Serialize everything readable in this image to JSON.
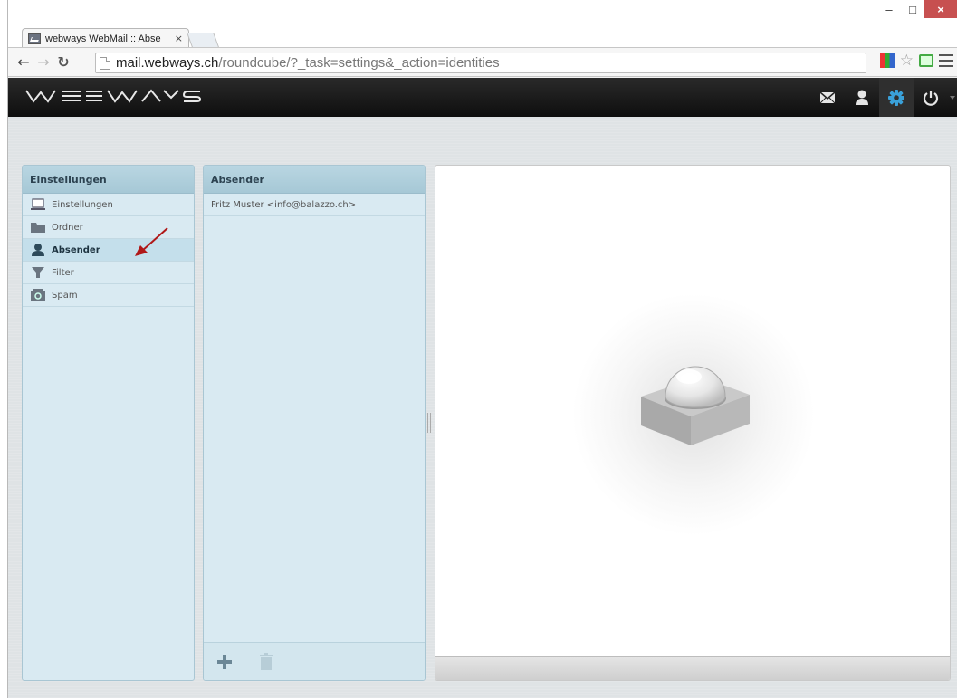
{
  "browser": {
    "tab_title": "webways WebMail :: Abse",
    "tab_close": "×",
    "url_host": "mail.webways.ch",
    "url_rest": "/roundcube/?_task=settings&_action=identities",
    "win_minimize": "–",
    "win_maximize": "□",
    "win_close": "×"
  },
  "app": {
    "logo": "WEBWAYS",
    "header_icons": [
      "mail-icon",
      "contacts-icon",
      "settings-icon",
      "logout-icon"
    ]
  },
  "settings_panel": {
    "title": "Einstellungen",
    "items": [
      {
        "label": "Einstellungen",
        "icon": "laptop-icon"
      },
      {
        "label": "Ordner",
        "icon": "folder-icon"
      },
      {
        "label": "Absender",
        "icon": "user-icon",
        "selected": true
      },
      {
        "label": "Filter",
        "icon": "filter-icon"
      },
      {
        "label": "Spam",
        "icon": "spam-icon"
      }
    ]
  },
  "identities_panel": {
    "title": "Absender",
    "items": [
      "Fritz Muster <info@balazzo.ch>"
    ],
    "add_label": "+",
    "delete_label": "delete"
  },
  "colors": {
    "header_bg": "#111111",
    "panel_bg": "#d9eaf2",
    "panel_head": "#aecfdd",
    "accent": "#3aa0d8"
  }
}
